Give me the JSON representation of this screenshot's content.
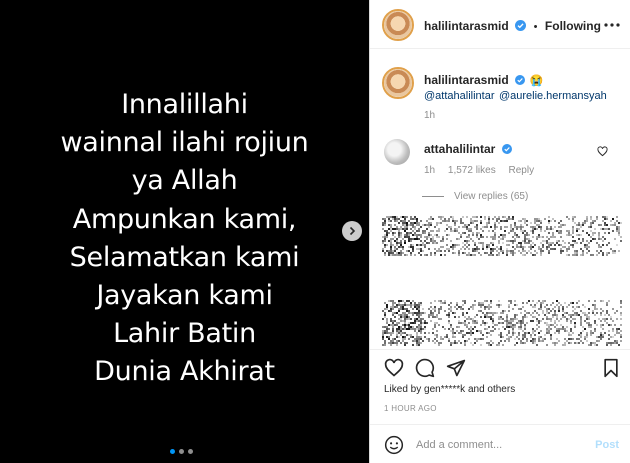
{
  "post": {
    "lines": [
      "Innalillahi",
      "wainnal ilahi rojiun",
      "ya Allah",
      "Ampunkan kami,",
      "Selamatkan kami",
      "Jayakan kami",
      "Lahir Batin",
      "Dunia Akhirat"
    ],
    "carousel_dots": 3,
    "active_dot": 0
  },
  "header": {
    "username": "halilintarasmid",
    "separator": "•",
    "follow_label": "Following"
  },
  "caption": {
    "username": "halilintarasmid",
    "emoji": "😭",
    "mention1": "@attahalilintar",
    "mention2": "@aurelie.hermansyah",
    "age": "1h"
  },
  "comment": {
    "username": "attahalilintar",
    "emoji": "",
    "age": "1h",
    "likes": "1,572 likes",
    "reply_label": "Reply",
    "view_replies": "View replies (65)"
  },
  "footer": {
    "liked_by": "Liked by gen*****k and others",
    "timestamp": "1 HOUR AGO",
    "comment_placeholder": "Add a comment...",
    "post_label": "Post"
  },
  "colors": {
    "verified": "#3897f0",
    "link": "#00376b",
    "post_disabled": "#b2dffc",
    "active_dot": "#0095f6"
  },
  "icons": [
    "heart-icon",
    "comment-icon",
    "share-icon",
    "bookmark-icon",
    "emoji-icon",
    "more-icon",
    "chevron-right-icon",
    "verified-icon"
  ]
}
